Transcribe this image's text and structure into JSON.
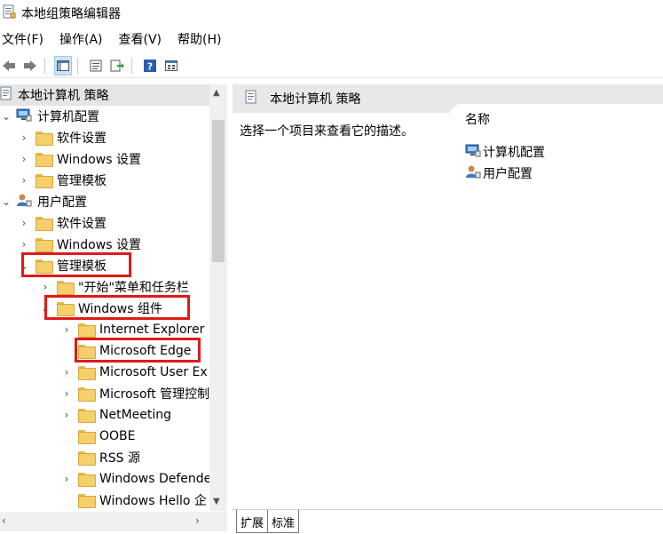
{
  "window": {
    "title": "本地组策略编辑器"
  },
  "menus": [
    "文件(F)",
    "操作(A)",
    "查看(V)",
    "帮助(H)"
  ],
  "tree": {
    "root": "本地计算机 策略",
    "computer_config": "计算机配置",
    "software_settings_1": "软件设置",
    "windows_settings_1": "Windows 设置",
    "admin_templates_1": "管理模板",
    "user_config": "用户配置",
    "software_settings_2": "软件设置",
    "windows_settings_2": "Windows 设置",
    "admin_templates_2": "管理模板",
    "start_menu": "\"开始\"菜单和任务栏",
    "windows_components": "Windows 组件",
    "internet_explorer": "Internet Explorer",
    "microsoft_edge": "Microsoft Edge",
    "microsoft_user_ex": "Microsoft User Ex",
    "microsoft_mgmt": "Microsoft 管理控制",
    "netmeeting": "NetMeeting",
    "oobe": "OOBE",
    "rss": "RSS 源",
    "windows_defender": "Windows Defende",
    "windows_hello": "Windows Hello 企"
  },
  "right": {
    "header": "本地计算机 策略",
    "description": "选择一个项目来查看它的描述。",
    "column_name": "名称",
    "items": [
      "计算机配置",
      "用户配置"
    ]
  },
  "tabs": [
    "扩展",
    "标准"
  ],
  "colors": {
    "highlight": "#e01a1a",
    "folder": "#f5cf6b"
  }
}
